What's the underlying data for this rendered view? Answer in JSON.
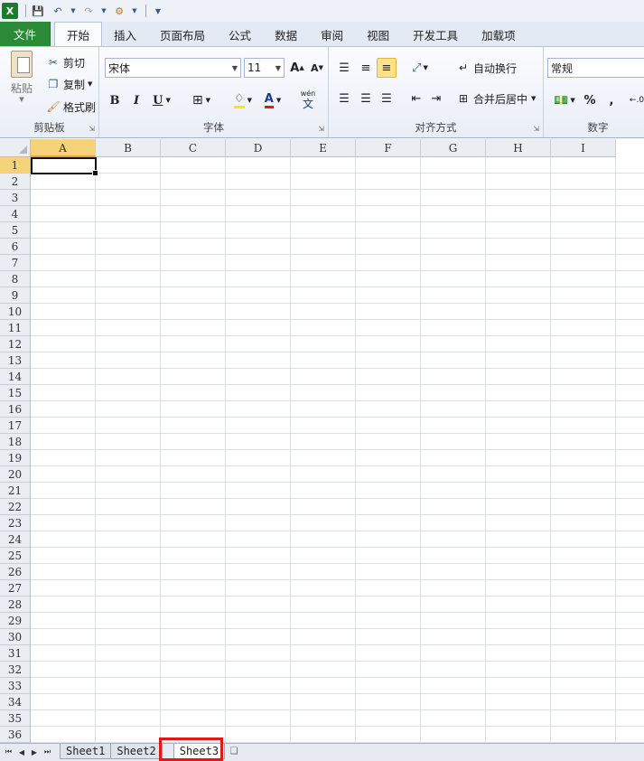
{
  "tabs": {
    "file": "文件",
    "items": [
      "开始",
      "插入",
      "页面布局",
      "公式",
      "数据",
      "审阅",
      "视图",
      "开发工具",
      "加载项"
    ],
    "active_index": 0
  },
  "clipboard": {
    "paste": "粘贴",
    "cut": "剪切",
    "copy": "复制",
    "format_painter": "格式刷",
    "group_label": "剪贴板"
  },
  "font": {
    "name": "宋体",
    "size": "11",
    "bold": "B",
    "italic": "I",
    "underline": "U",
    "text_color_glyph": "A",
    "grow": "A",
    "shrink": "A",
    "phonetic": "wén",
    "phonetic_char": "文",
    "group_label": "字体"
  },
  "alignment": {
    "wrap_text": "自动换行",
    "merge_center": "合并后居中",
    "group_label": "对齐方式"
  },
  "number": {
    "format": "常规",
    "percent": "%",
    "comma": ",",
    "group_label": "数字"
  },
  "sheet": {
    "columns": [
      "A",
      "B",
      "C",
      "D",
      "E",
      "F",
      "G",
      "H",
      "I"
    ],
    "rows": [
      "1",
      "2",
      "3",
      "4",
      "5",
      "6",
      "7",
      "8",
      "9",
      "10",
      "11",
      "12",
      "13",
      "14",
      "15",
      "16",
      "17",
      "18",
      "19",
      "20",
      "21",
      "22",
      "23",
      "24",
      "25",
      "26",
      "27",
      "28",
      "29",
      "30",
      "31",
      "32",
      "33",
      "34",
      "35",
      "36"
    ],
    "active_cell": "A1"
  },
  "sheet_tabs": [
    "Sheet1",
    "Sheet2",
    "Sheet3"
  ],
  "colors": {
    "file_tab": "#2a8a35",
    "highlight": "#e01818",
    "selection": "#f6d27a"
  }
}
